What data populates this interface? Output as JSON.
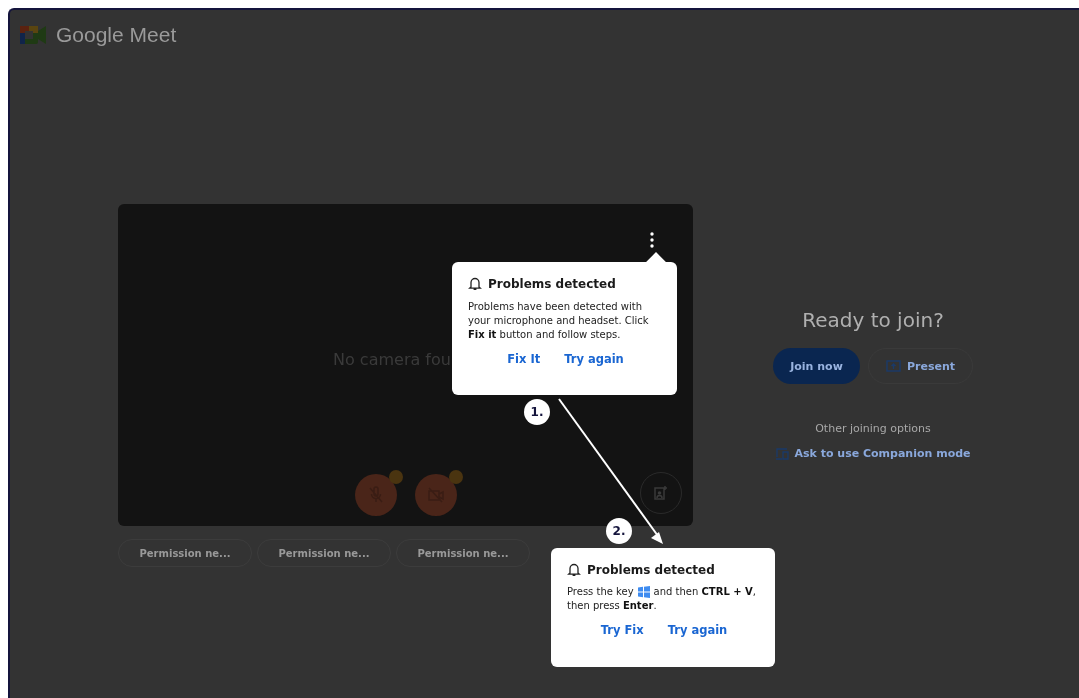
{
  "app": {
    "name": "Google Meet"
  },
  "preview": {
    "message": "No camera fou",
    "permission_chips": [
      "Permission ne...",
      "Permission ne...",
      "Permission ne..."
    ]
  },
  "join_panel": {
    "title": "Ready to join?",
    "join_button": "Join now",
    "present_button": "Present",
    "other_options": "Other joining options",
    "companion_link": "Ask to use Companion mode"
  },
  "popups": [
    {
      "step": "1.",
      "title": "Problems detected",
      "body": "Problems have been detected with your microphone and headset. Click **Fix it** button and follow steps.",
      "actions": [
        "Fix It",
        "Try again"
      ]
    },
    {
      "step": "2.",
      "title": "Problems detected",
      "body_before_key": "Press the key",
      "body_after_key": "and then **CTRL + V**,",
      "body_line_2": "then press **Enter**.",
      "actions": [
        "Try Fix",
        "Try again"
      ]
    }
  ]
}
